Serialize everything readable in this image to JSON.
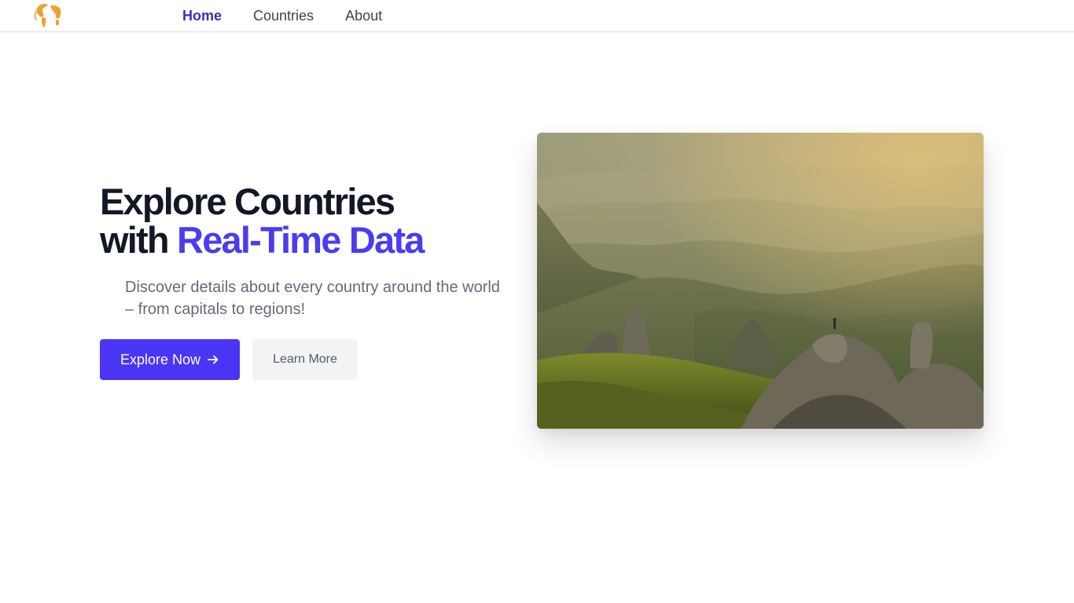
{
  "app": {
    "logo_icon": "globe-icon",
    "colors": {
      "brand_accent": "#4b3cf0",
      "primary_button": "#4b35f5",
      "active_nav": "#3b2fb8",
      "logo": "#f0a030"
    }
  },
  "nav": {
    "items": [
      {
        "label": "Home",
        "active": true
      },
      {
        "label": "Countries",
        "active": false
      },
      {
        "label": "About",
        "active": false
      }
    ]
  },
  "hero": {
    "title_line1": "Explore Countries",
    "title_line2_prefix": "with ",
    "title_line2_accent": "Real-Time Data",
    "description": "Discover details about every country around the world – from capitals to regions!",
    "primary_button": {
      "label": "Explore Now",
      "icon": "arrow-right-icon"
    },
    "secondary_button": {
      "label": "Learn More"
    },
    "image": {
      "subject": "mountain-landscape-photo"
    }
  }
}
